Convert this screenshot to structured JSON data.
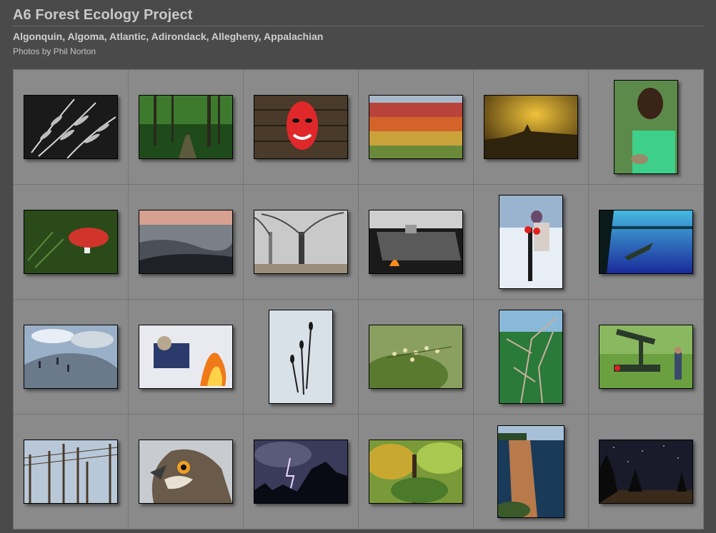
{
  "header": {
    "title": "A6 Forest Ecology Project",
    "subtitle": "Algonquin, Algoma, Atlantic, Adirondack, Allegheny, Appalachian",
    "credit": "Photos by Phil Norton"
  },
  "gallery": {
    "thumbnails": [
      {
        "name": "thumb-fern-bw",
        "orientation": "landscape"
      },
      {
        "name": "thumb-forest-path",
        "orientation": "landscape"
      },
      {
        "name": "thumb-red-mask",
        "orientation": "landscape"
      },
      {
        "name": "thumb-autumn-hills",
        "orientation": "landscape"
      },
      {
        "name": "thumb-foggy-sunrise",
        "orientation": "landscape"
      },
      {
        "name": "thumb-girl-nest",
        "orientation": "portrait"
      },
      {
        "name": "thumb-red-mushroom",
        "orientation": "landscape"
      },
      {
        "name": "thumb-misty-valley",
        "orientation": "landscape"
      },
      {
        "name": "thumb-foggy-maple",
        "orientation": "landscape"
      },
      {
        "name": "thumb-sugar-evaporator",
        "orientation": "landscape"
      },
      {
        "name": "thumb-ice-saw",
        "orientation": "portrait"
      },
      {
        "name": "thumb-canoe-lake",
        "orientation": "landscape"
      },
      {
        "name": "thumb-rocky-summit",
        "orientation": "landscape"
      },
      {
        "name": "thumb-campfire",
        "orientation": "landscape"
      },
      {
        "name": "thumb-winter-seedheads",
        "orientation": "portrait"
      },
      {
        "name": "thumb-green-buds",
        "orientation": "landscape"
      },
      {
        "name": "thumb-bare-branches",
        "orientation": "portrait"
      },
      {
        "name": "thumb-oil-pump",
        "orientation": "landscape"
      },
      {
        "name": "thumb-utility-poles",
        "orientation": "landscape"
      },
      {
        "name": "thumb-hawk",
        "orientation": "landscape"
      },
      {
        "name": "thumb-lightning",
        "orientation": "landscape"
      },
      {
        "name": "thumb-autumn-foliage",
        "orientation": "landscape"
      },
      {
        "name": "thumb-cliff-waterfall",
        "orientation": "portrait"
      },
      {
        "name": "thumb-star-trails",
        "orientation": "landscape"
      }
    ]
  }
}
